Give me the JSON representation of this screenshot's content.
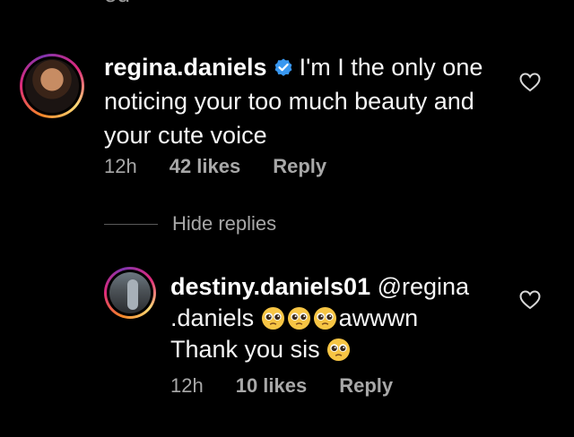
{
  "top_cutoff_text": "od",
  "comment": {
    "username": "regina.daniels",
    "text_line1": "I'm I the only one",
    "text_line2": "noticing your too much beauty and",
    "text_line3": "your cute voice",
    "time": "12h",
    "likes": "42 likes",
    "reply_label": "Reply"
  },
  "hide_replies_label": "Hide replies",
  "reply": {
    "username": "destiny.daniels01",
    "mention_part1": "@regina",
    "mention_part2": ".daniels",
    "after_emojis": "awwwn",
    "line3": "Thank you sis",
    "time": "12h",
    "likes": "10 likes",
    "reply_label": "Reply"
  },
  "icons": {
    "verified": "verified-badge-icon",
    "like": "heart-outline-icon",
    "emoji": "pleading-face-emoji"
  },
  "colors": {
    "background": "#000000",
    "text": "#f5f5f5",
    "secondary": "#a8a8a8",
    "verified_blue": "#3897f0",
    "emoji_yellow": "#f7c544"
  }
}
